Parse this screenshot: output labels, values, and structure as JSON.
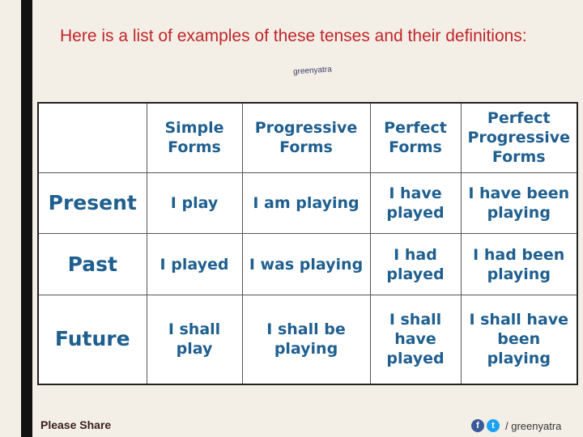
{
  "heading": "Here is a list of examples of these tenses and their definitions:",
  "watermark": "greenyatra",
  "table": {
    "columns": [
      "",
      "Simple Forms",
      "Progressive Forms",
      "Perfect Forms",
      "Perfect Progressive Forms"
    ],
    "rows": [
      {
        "label": "Present",
        "cells": [
          "I play",
          "I am playing",
          "I have played",
          "I have been playing"
        ]
      },
      {
        "label": "Past",
        "cells": [
          "I played",
          "I was playing",
          "I had played",
          "I had been playing"
        ]
      },
      {
        "label": "Future",
        "cells": [
          "I shall play",
          "I shall be playing",
          "I shall have played",
          "I shall have been playing"
        ]
      }
    ]
  },
  "footer": {
    "share": "Please Share",
    "facebook_glyph": "f",
    "twitter_glyph": "t",
    "handle": "/ greenyatra"
  },
  "colors": {
    "heading": "#c0262a",
    "table_text": "#1f5f8f",
    "background": "#f3efe6"
  }
}
